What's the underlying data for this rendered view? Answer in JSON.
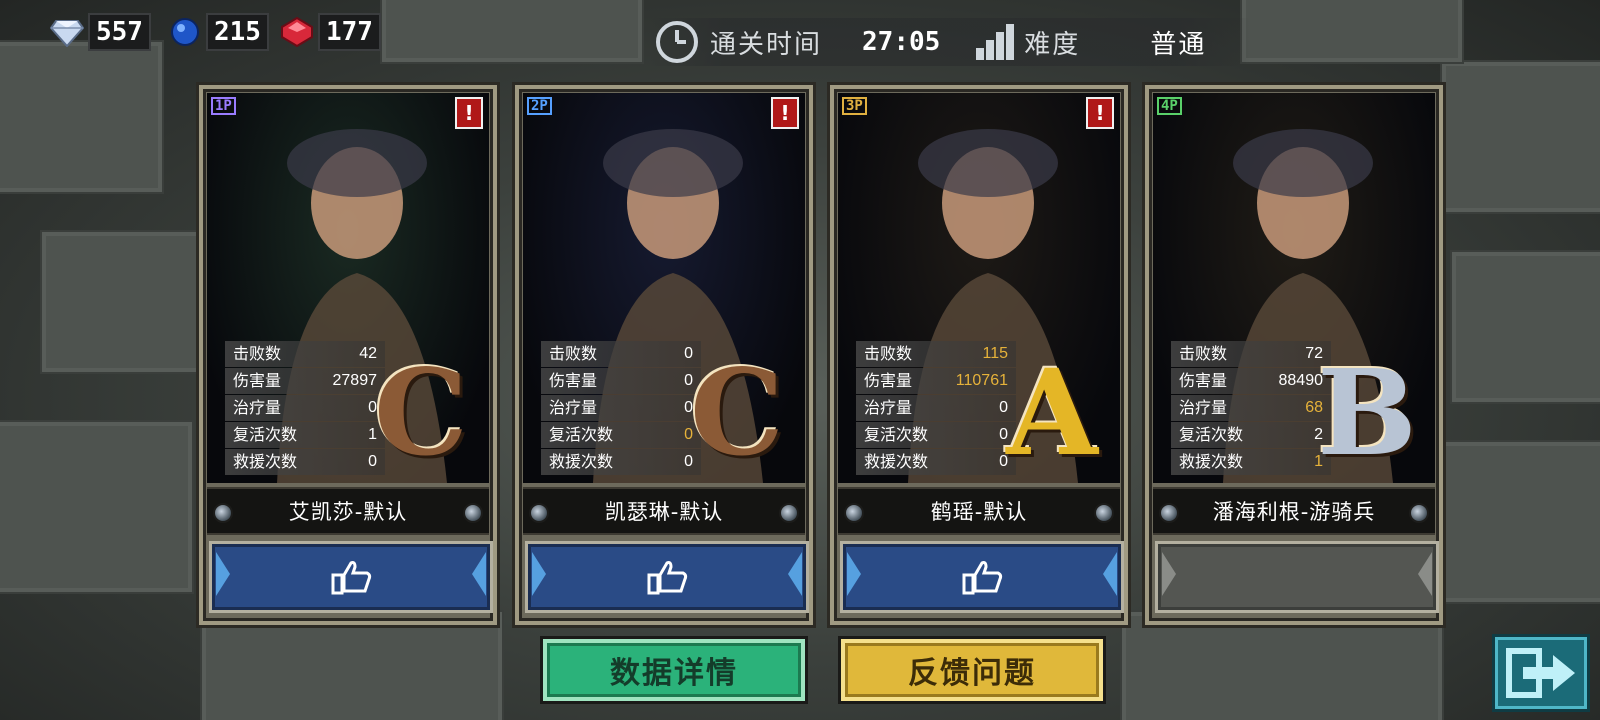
{
  "currencies": [
    {
      "icon": "diamond-icon",
      "value": "557",
      "color": "#c9d9f0"
    },
    {
      "icon": "blue-gem-icon",
      "value": "215",
      "color": "#1f56c8"
    },
    {
      "icon": "red-gem-icon",
      "value": "177",
      "color": "#d8283a"
    }
  ],
  "infobar": {
    "time_label": "通关时间",
    "time_value": "27:05",
    "difficulty_label": "难度",
    "difficulty_value": "普通"
  },
  "cards": [
    {
      "player": "1P",
      "player_color": "#9a7cff",
      "alert": true,
      "name": "艾凯莎-默认",
      "grade": "C",
      "grade_color": "#8b5a36",
      "portrait_bg": "#1a2a22",
      "stats": [
        {
          "label": "击败数",
          "value": "42",
          "highlight": false
        },
        {
          "label": "伤害量",
          "value": "27897",
          "highlight": false
        },
        {
          "label": "治疗量",
          "value": "0",
          "highlight": false
        },
        {
          "label": "复活次数",
          "value": "1",
          "highlight": false
        },
        {
          "label": "救援次数",
          "value": "0",
          "highlight": false
        }
      ],
      "like_enabled": true
    },
    {
      "player": "2P",
      "player_color": "#56a0ff",
      "alert": true,
      "name": "凯瑟琳-默认",
      "grade": "C",
      "grade_color": "#8b5a36",
      "portrait_bg": "#161a30",
      "stats": [
        {
          "label": "击败数",
          "value": "0",
          "highlight": false
        },
        {
          "label": "伤害量",
          "value": "0",
          "highlight": false
        },
        {
          "label": "治疗量",
          "value": "0",
          "highlight": false
        },
        {
          "label": "复活次数",
          "value": "0",
          "highlight": true
        },
        {
          "label": "救援次数",
          "value": "0",
          "highlight": false
        }
      ],
      "like_enabled": true
    },
    {
      "player": "3P",
      "player_color": "#e0b040",
      "alert": true,
      "name": "鹤瑶-默认",
      "grade": "A",
      "grade_color": "#e4b626",
      "portrait_bg": "#1e1a16",
      "stats": [
        {
          "label": "击败数",
          "value": "115",
          "highlight": true
        },
        {
          "label": "伤害量",
          "value": "110761",
          "highlight": true
        },
        {
          "label": "治疗量",
          "value": "0",
          "highlight": false
        },
        {
          "label": "复活次数",
          "value": "0",
          "highlight": false
        },
        {
          "label": "救援次数",
          "value": "0",
          "highlight": false
        }
      ],
      "like_enabled": true
    },
    {
      "player": "4P",
      "player_color": "#5ad06a",
      "alert": false,
      "name": "潘海利根-游骑兵",
      "grade": "B",
      "grade_color": "#b8c4d4",
      "portrait_bg": "#201c16",
      "stats": [
        {
          "label": "击败数",
          "value": "72",
          "highlight": false
        },
        {
          "label": "伤害量",
          "value": "88490",
          "highlight": false
        },
        {
          "label": "治疗量",
          "value": "68",
          "highlight": true
        },
        {
          "label": "复活次数",
          "value": "2",
          "highlight": false
        },
        {
          "label": "救援次数",
          "value": "1",
          "highlight": true
        }
      ],
      "like_enabled": false
    }
  ],
  "buttons": {
    "details": "数据详情",
    "feedback": "反馈问题"
  }
}
